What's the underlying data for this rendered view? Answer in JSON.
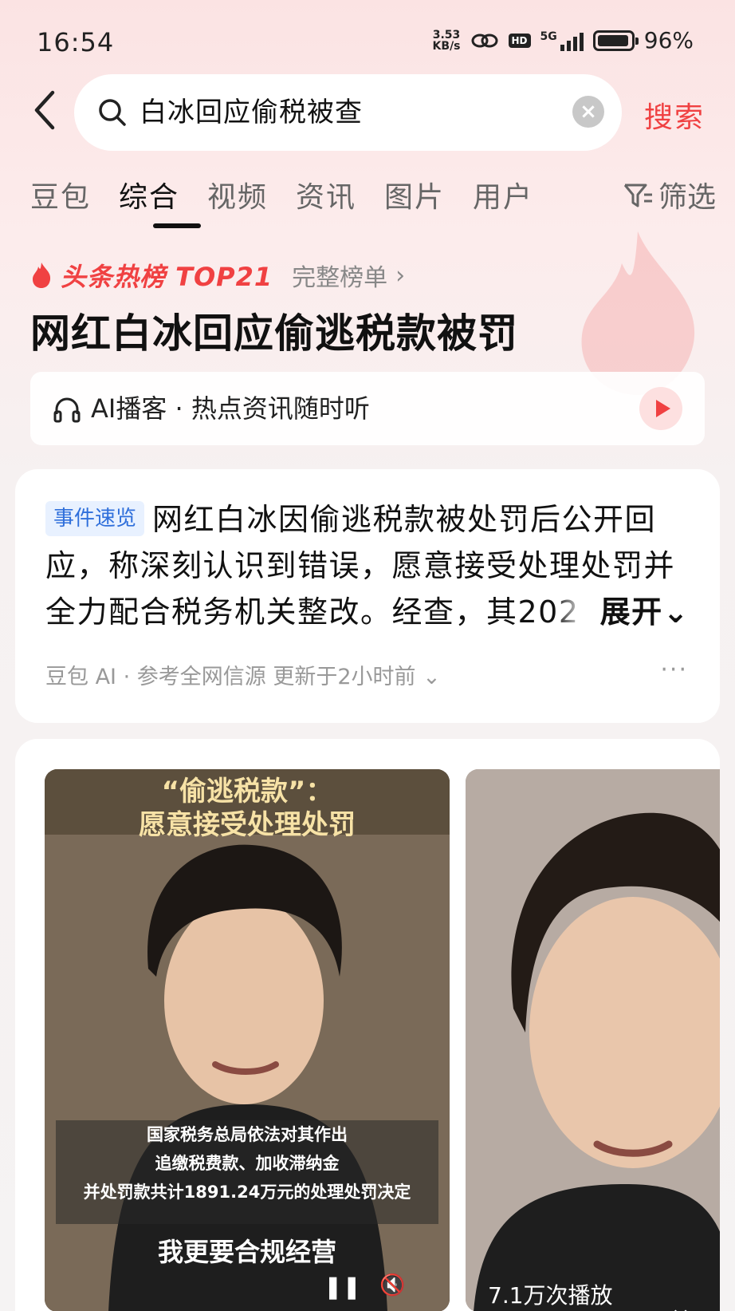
{
  "status_bar": {
    "time": "16:54",
    "net_speed_value": "3.53",
    "net_speed_unit": "KB/s",
    "hd": "HD",
    "network": "5G",
    "battery": "96%"
  },
  "search": {
    "query": "白冰回应偷税被查",
    "clear_icon": "×",
    "button": "搜索"
  },
  "tabs": [
    "豆包",
    "综合",
    "视频",
    "资讯",
    "图片",
    "用户"
  ],
  "active_tab": "综合",
  "filter_label": "筛选",
  "hot_rank": {
    "label": "头条热榜 TOP21",
    "full_list": "完整榜单",
    "chevron": "›"
  },
  "headline": "网红白冰回应偷逃税款被罚",
  "podcast": {
    "label": "AI播客 · 热点资讯随时听"
  },
  "summary": {
    "tag": "事件速览",
    "line1": "网红白冰因偷逃税款被处罚后公开回",
    "line2": "应，称深刻认识到错误，愿意接受处理处罚并",
    "line3": "全力配合税务机关整改。经查，其202",
    "expand": "展开⌄",
    "meta": "豆包 AI · 参考全网信源 更新于2小时前 ⌄",
    "more": "···"
  },
  "video1": {
    "caption_top_1": "“偷逃税款”：",
    "caption_top_2": "愿意接受处理处罚",
    "subtitle_1": "国家税务总局依法对其作出",
    "subtitle_2": "追缴税费款、加收滞纳金",
    "subtitle_3": "并处罚款共计1891.24万元的处理处罚决定",
    "subtitle_big": "我更要合规经营",
    "pause": "❚❚",
    "mute": "🔇"
  },
  "video2": {
    "plays": "7.1万次播放",
    "close": "×"
  },
  "colors": {
    "accent": "#f04142",
    "tag_blue": "#2f6fdb"
  }
}
